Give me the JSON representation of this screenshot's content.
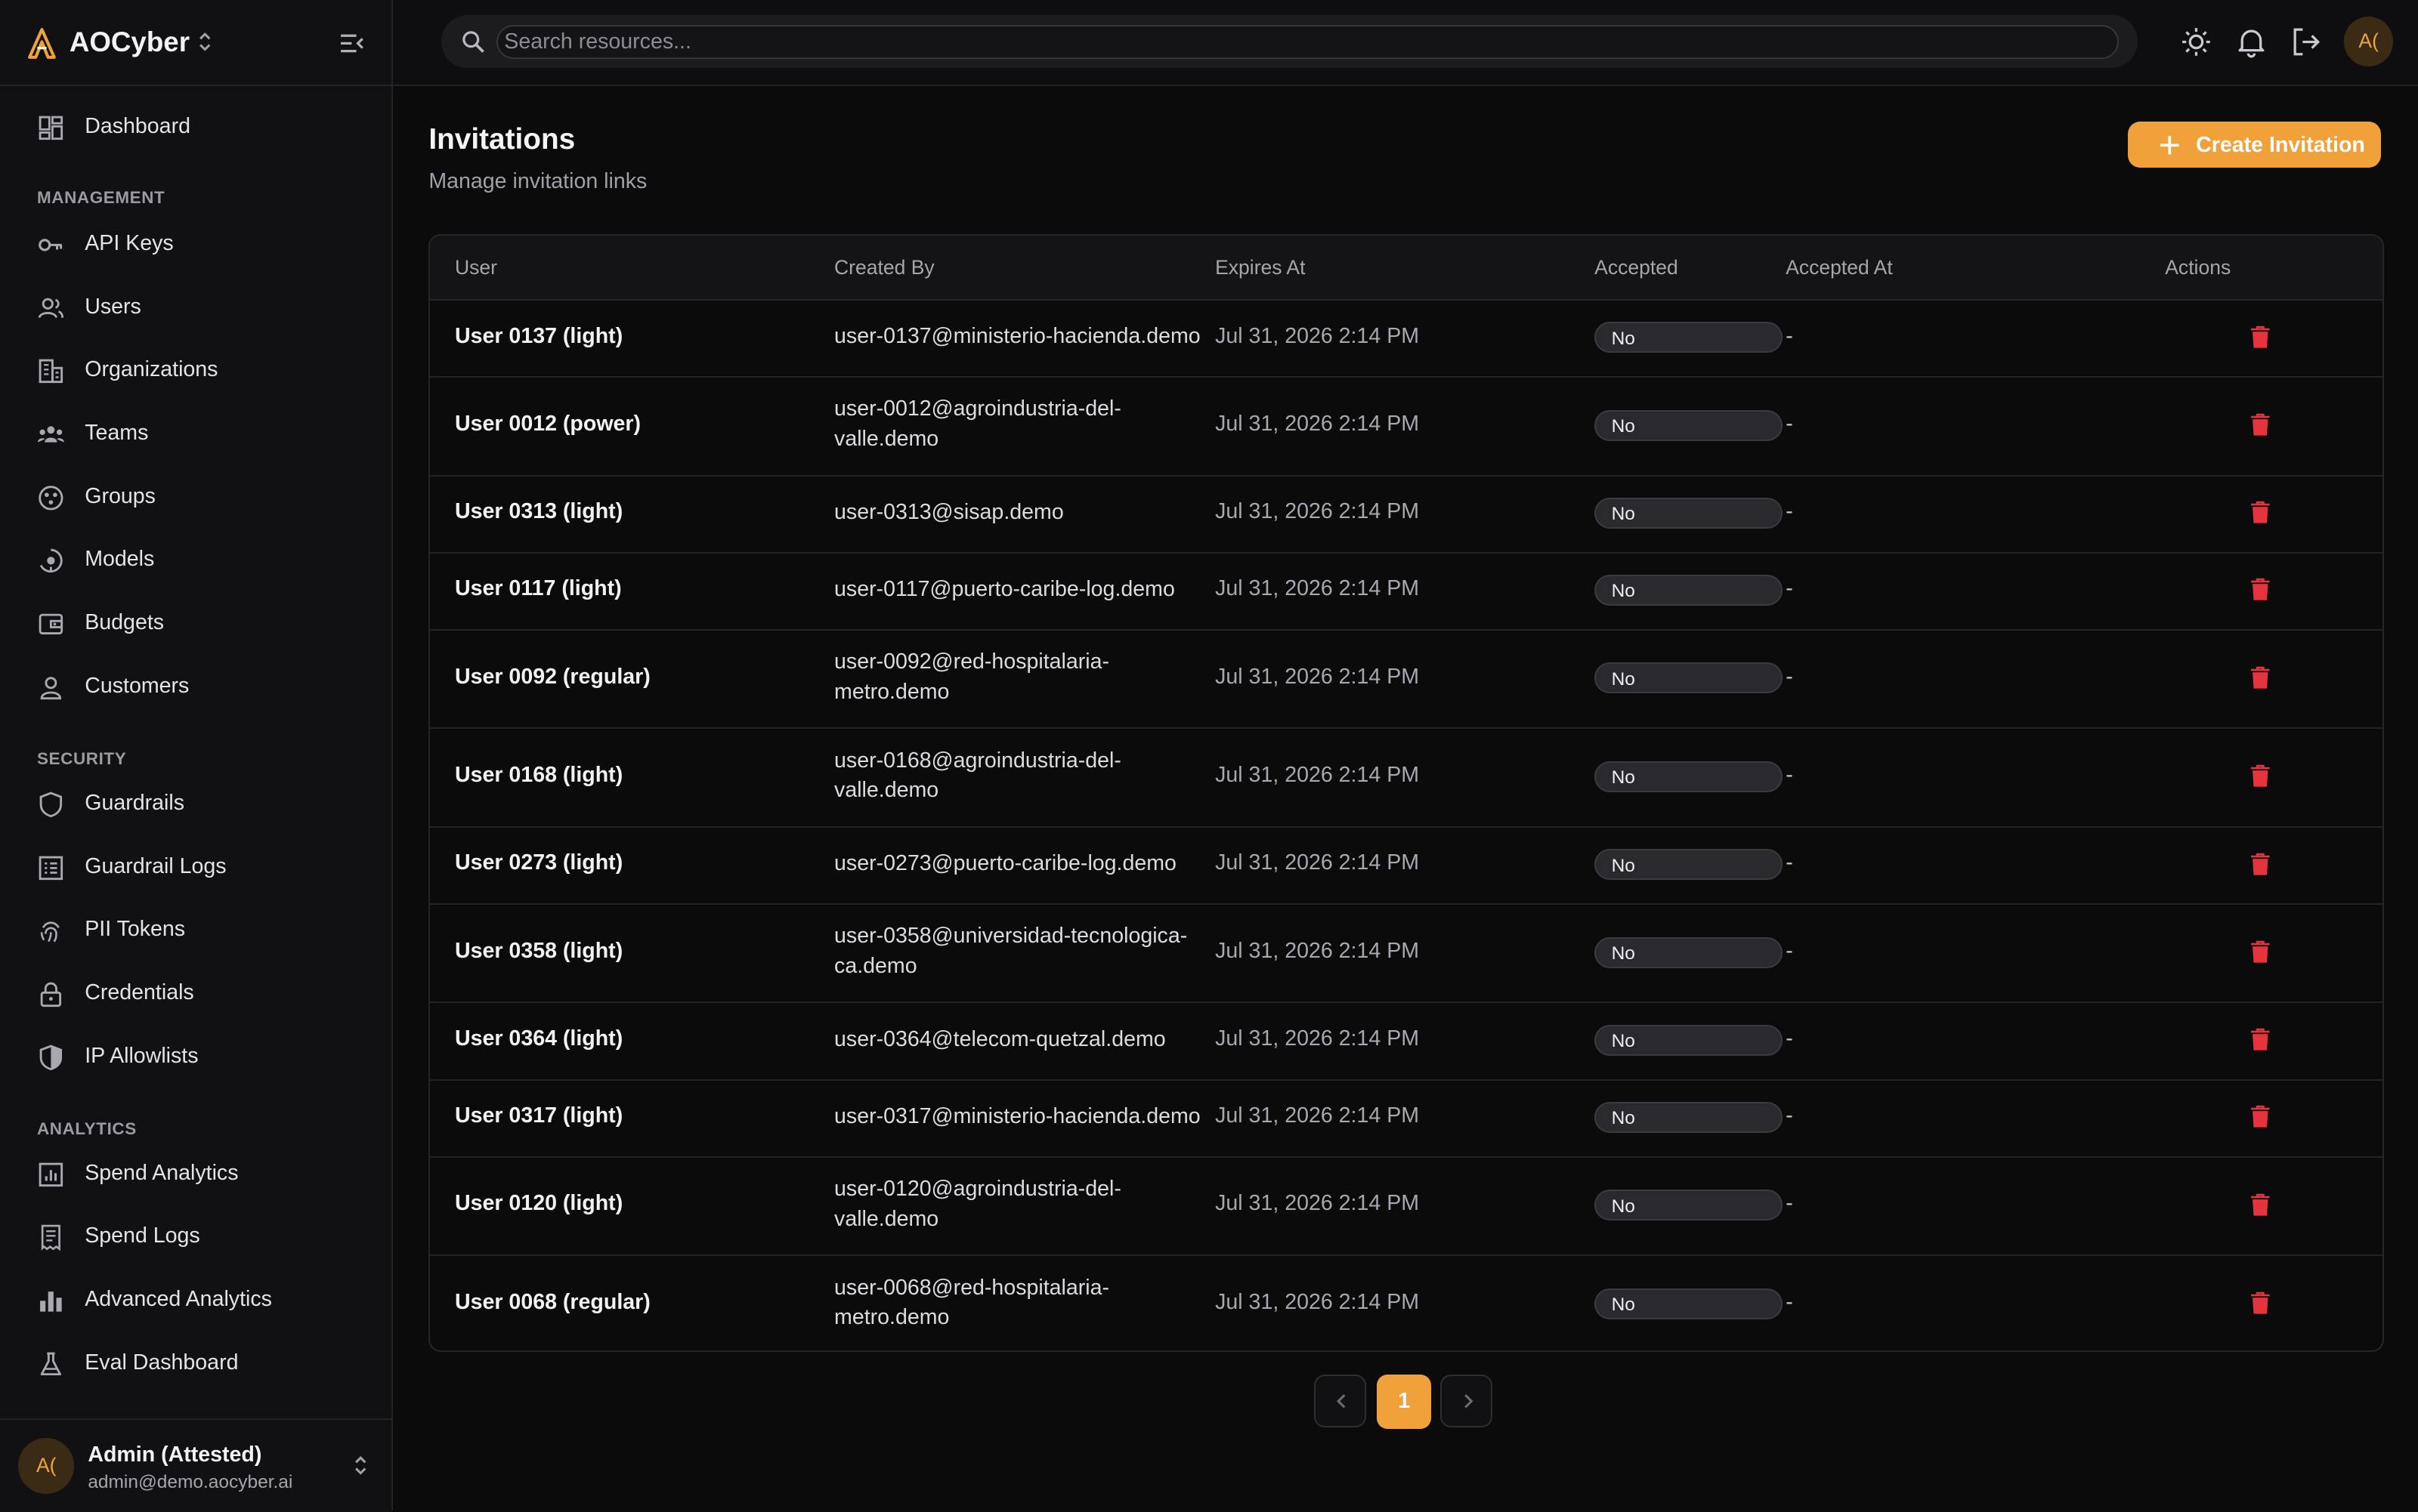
{
  "brand": {
    "name": "AOCyber"
  },
  "sidebar": {
    "items": [
      {
        "label": "Dashboard"
      },
      {
        "label": "API Keys"
      },
      {
        "label": "Users"
      },
      {
        "label": "Organizations"
      },
      {
        "label": "Teams"
      },
      {
        "label": "Groups"
      },
      {
        "label": "Models"
      },
      {
        "label": "Budgets"
      },
      {
        "label": "Customers"
      },
      {
        "label": "Guardrails"
      },
      {
        "label": "Guardrail Logs"
      },
      {
        "label": "PII Tokens"
      },
      {
        "label": "Credentials"
      },
      {
        "label": "IP Allowlists"
      },
      {
        "label": "Spend Analytics"
      },
      {
        "label": "Spend Logs"
      },
      {
        "label": "Advanced Analytics"
      },
      {
        "label": "Eval Dashboard"
      }
    ],
    "sections": {
      "management": "MANAGEMENT",
      "security": "SECURITY",
      "analytics": "ANALYTICS"
    }
  },
  "account": {
    "initials": "A(",
    "name": "Admin (Attested)",
    "email": "admin@demo.aocyber.ai"
  },
  "search": {
    "placeholder": "Search resources..."
  },
  "page": {
    "title": "Invitations",
    "subtitle": "Manage invitation links",
    "create_label": "Create Invitation"
  },
  "table": {
    "headers": {
      "user": "User",
      "created_by": "Created By",
      "expires_at": "Expires At",
      "accepted": "Accepted",
      "accepted_at": "Accepted At",
      "actions": "Actions"
    },
    "rows": [
      {
        "user": "User 0137 (light)",
        "created_by": "user-0137@ministerio-hacienda.demo",
        "expires_at": "Jul 31, 2026 2:14 PM",
        "accepted": "No",
        "accepted_at": "-"
      },
      {
        "user": "User 0012 (power)",
        "created_by": "user-0012@agroindustria-del-valle.demo",
        "expires_at": "Jul 31, 2026 2:14 PM",
        "accepted": "No",
        "accepted_at": "-"
      },
      {
        "user": "User 0313 (light)",
        "created_by": "user-0313@sisap.demo",
        "expires_at": "Jul 31, 2026 2:14 PM",
        "accepted": "No",
        "accepted_at": "-"
      },
      {
        "user": "User 0117 (light)",
        "created_by": "user-0117@puerto-caribe-log.demo",
        "expires_at": "Jul 31, 2026 2:14 PM",
        "accepted": "No",
        "accepted_at": "-"
      },
      {
        "user": "User 0092 (regular)",
        "created_by": "user-0092@red-hospitalaria-metro.demo",
        "expires_at": "Jul 31, 2026 2:14 PM",
        "accepted": "No",
        "accepted_at": "-"
      },
      {
        "user": "User 0168 (light)",
        "created_by": "user-0168@agroindustria-del-valle.demo",
        "expires_at": "Jul 31, 2026 2:14 PM",
        "accepted": "No",
        "accepted_at": "-"
      },
      {
        "user": "User 0273 (light)",
        "created_by": "user-0273@puerto-caribe-log.demo",
        "expires_at": "Jul 31, 2026 2:14 PM",
        "accepted": "No",
        "accepted_at": "-"
      },
      {
        "user": "User 0358 (light)",
        "created_by": "user-0358@universidad-tecnologica-ca.demo",
        "expires_at": "Jul 31, 2026 2:14 PM",
        "accepted": "No",
        "accepted_at": "-"
      },
      {
        "user": "User 0364 (light)",
        "created_by": "user-0364@telecom-quetzal.demo",
        "expires_at": "Jul 31, 2026 2:14 PM",
        "accepted": "No",
        "accepted_at": "-"
      },
      {
        "user": "User 0317 (light)",
        "created_by": "user-0317@ministerio-hacienda.demo",
        "expires_at": "Jul 31, 2026 2:14 PM",
        "accepted": "No",
        "accepted_at": "-"
      },
      {
        "user": "User 0120 (light)",
        "created_by": "user-0120@agroindustria-del-valle.demo",
        "expires_at": "Jul 31, 2026 2:14 PM",
        "accepted": "No",
        "accepted_at": "-"
      },
      {
        "user": "User 0068 (regular)",
        "created_by": "user-0068@red-hospitalaria-metro.demo",
        "expires_at": "Jul 31, 2026 2:14 PM",
        "accepted": "No",
        "accepted_at": "-"
      }
    ]
  },
  "pagination": {
    "current": "1"
  },
  "colors": {
    "accent": "#f0a13a",
    "danger": "#e5343d",
    "background": "#0b0b0c",
    "sidebar": "#111113"
  },
  "icons": {
    "sidebar": [
      "dashboard-icon",
      "key-icon",
      "users-icon",
      "building-icon",
      "teams-icon",
      "groups-icon",
      "models-icon",
      "wallet-icon",
      "person-icon",
      "shield-icon",
      "list-icon",
      "fingerprint-icon",
      "lock-icon",
      "shield-half-icon",
      "chart-icon",
      "receipt-icon",
      "bar-chart-icon",
      "flask-icon"
    ],
    "topbar": [
      "search-icon",
      "sun-icon",
      "bell-icon",
      "logout-icon"
    ],
    "row_action": "trash-icon"
  }
}
